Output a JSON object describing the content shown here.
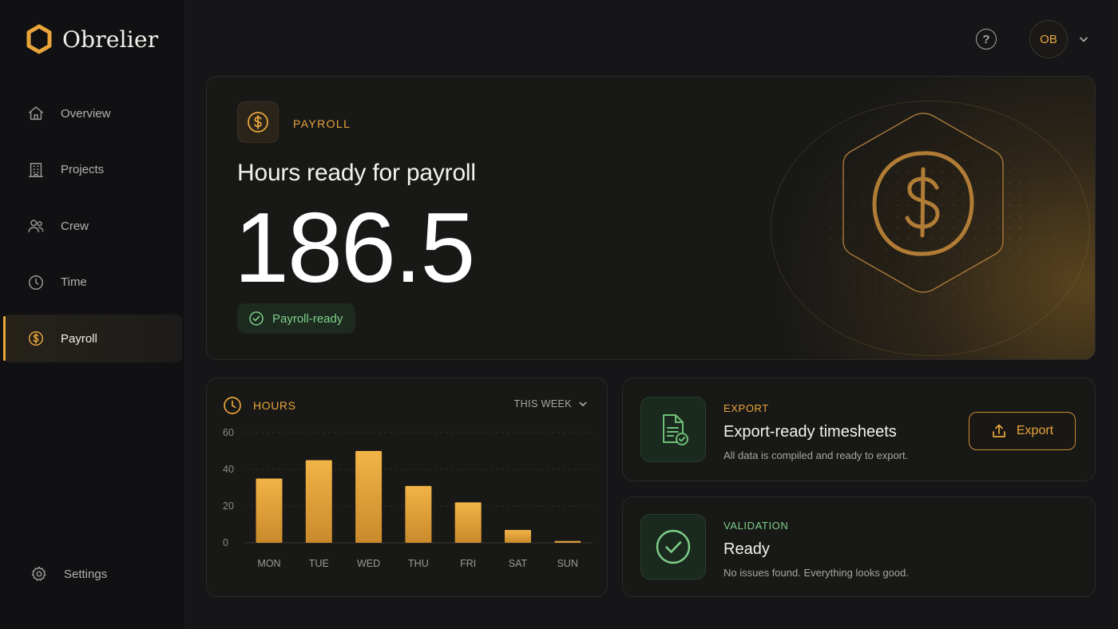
{
  "app": {
    "name": "Obrelier"
  },
  "sidebar": {
    "items": [
      {
        "label": "Overview",
        "icon": "home-icon"
      },
      {
        "label": "Projects",
        "icon": "building-icon"
      },
      {
        "label": "Crew",
        "icon": "users-icon"
      },
      {
        "label": "Time",
        "icon": "clock-icon"
      },
      {
        "label": "Payroll",
        "icon": "dollar-icon",
        "active": true
      }
    ],
    "settings_label": "Settings"
  },
  "header": {
    "help_icon": "help-icon",
    "help_glyph": "?",
    "avatar_initials": "OB"
  },
  "hero": {
    "kicker": "PAYROLL",
    "title": "Hours ready for payroll",
    "value": "186.5",
    "status": "Payroll-ready"
  },
  "hours_card": {
    "title": "HOURS",
    "range": "THIS WEEK"
  },
  "chart_data": {
    "type": "bar",
    "categories": [
      "MON",
      "TUE",
      "WED",
      "THU",
      "FRI",
      "SAT",
      "SUN"
    ],
    "values": [
      35,
      45,
      50,
      31,
      22,
      7,
      1
    ],
    "ylim": [
      0,
      60
    ],
    "yticks": [
      0,
      20,
      40,
      60
    ],
    "grid": true,
    "color": "#e9a53b"
  },
  "export_card": {
    "kicker": "EXPORT",
    "title": "Export-ready timesheets",
    "description": "All data is compiled and ready to export.",
    "button_label": "Export"
  },
  "validation_card": {
    "kicker": "VALIDATION",
    "title": "Ready",
    "description": "No issues found. Everything looks good."
  },
  "colors": {
    "accent": "#e9a53b",
    "success": "#7fd08a",
    "background": "#161618"
  }
}
